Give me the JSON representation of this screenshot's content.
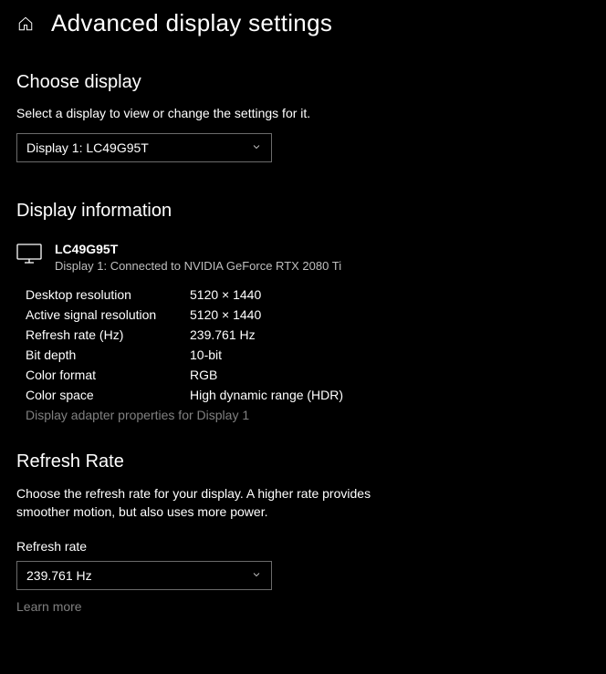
{
  "header": {
    "title": "Advanced display settings"
  },
  "chooseDisplay": {
    "heading": "Choose display",
    "subtext": "Select a display to view or change the settings for it.",
    "selected": "Display 1: LC49G95T"
  },
  "displayInfo": {
    "heading": "Display information",
    "name": "LC49G95T",
    "sub": "Display 1: Connected to NVIDIA GeForce RTX 2080 Ti",
    "rows": {
      "desktopResLabel": "Desktop resolution",
      "desktopResValue": "5120 × 1440",
      "activeResLabel": "Active signal resolution",
      "activeResValue": "5120 × 1440",
      "refreshLabel": "Refresh rate (Hz)",
      "refreshValue": "239.761 Hz",
      "bitDepthLabel": "Bit depth",
      "bitDepthValue": "10-bit",
      "colorFormatLabel": "Color format",
      "colorFormatValue": "RGB",
      "colorSpaceLabel": "Color space",
      "colorSpaceValue": "High dynamic range (HDR)"
    },
    "adapterLink": "Display adapter properties for Display 1"
  },
  "refreshRate": {
    "heading": "Refresh Rate",
    "desc": "Choose the refresh rate for your display. A higher rate provides smoother motion, but also uses more power.",
    "fieldLabel": "Refresh rate",
    "selected": "239.761 Hz",
    "learnMore": "Learn more"
  }
}
